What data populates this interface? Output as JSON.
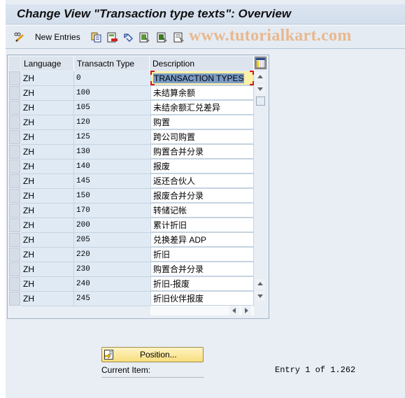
{
  "window": {
    "title": "Change View \"Transaction type texts\": Overview"
  },
  "toolbar": {
    "items": [
      {
        "icon": "pencil-glasses-icon",
        "label": ""
      },
      {
        "icon": "new-entries-label",
        "label": "New Entries"
      },
      {
        "icon": "copy-icon",
        "label": ""
      },
      {
        "icon": "delete-icon",
        "label": ""
      },
      {
        "icon": "undo-change-icon",
        "label": ""
      },
      {
        "icon": "select-all-icon",
        "label": ""
      },
      {
        "icon": "select-block-icon",
        "label": ""
      },
      {
        "icon": "deselect-all-icon",
        "label": ""
      }
    ],
    "watermark": "www.tutorialkart.com"
  },
  "table": {
    "columns": [
      "Language",
      "Transactn Type",
      "Description"
    ],
    "rows": [
      {
        "language": "ZH",
        "type": "0",
        "description": "TRANSACTION TYPES"
      },
      {
        "language": "ZH",
        "type": "100",
        "description": "未结算余额"
      },
      {
        "language": "ZH",
        "type": "105",
        "description": "未结余额汇兑差异"
      },
      {
        "language": "ZH",
        "type": "120",
        "description": "购置"
      },
      {
        "language": "ZH",
        "type": "125",
        "description": "跨公司购置"
      },
      {
        "language": "ZH",
        "type": "130",
        "description": "购置合并分录"
      },
      {
        "language": "ZH",
        "type": "140",
        "description": "报废"
      },
      {
        "language": "ZH",
        "type": "145",
        "description": "返还合伙人"
      },
      {
        "language": "ZH",
        "type": "150",
        "description": "报废合并分录"
      },
      {
        "language": "ZH",
        "type": "170",
        "description": "转储记帐"
      },
      {
        "language": "ZH",
        "type": "200",
        "description": "累计折旧"
      },
      {
        "language": "ZH",
        "type": "205",
        "description": "兑换差异 ADP"
      },
      {
        "language": "ZH",
        "type": "220",
        "description": "折旧"
      },
      {
        "language": "ZH",
        "type": "230",
        "description": "购置合并分录"
      },
      {
        "language": "ZH",
        "type": "240",
        "description": "折旧-报废"
      },
      {
        "language": "ZH",
        "type": "245",
        "description": "折旧伙伴报废"
      }
    ],
    "focused_row": 0
  },
  "footer": {
    "position_button": "Position...",
    "current_item_label": "Current Item:",
    "entry_status": "Entry 1 of 1.262"
  }
}
